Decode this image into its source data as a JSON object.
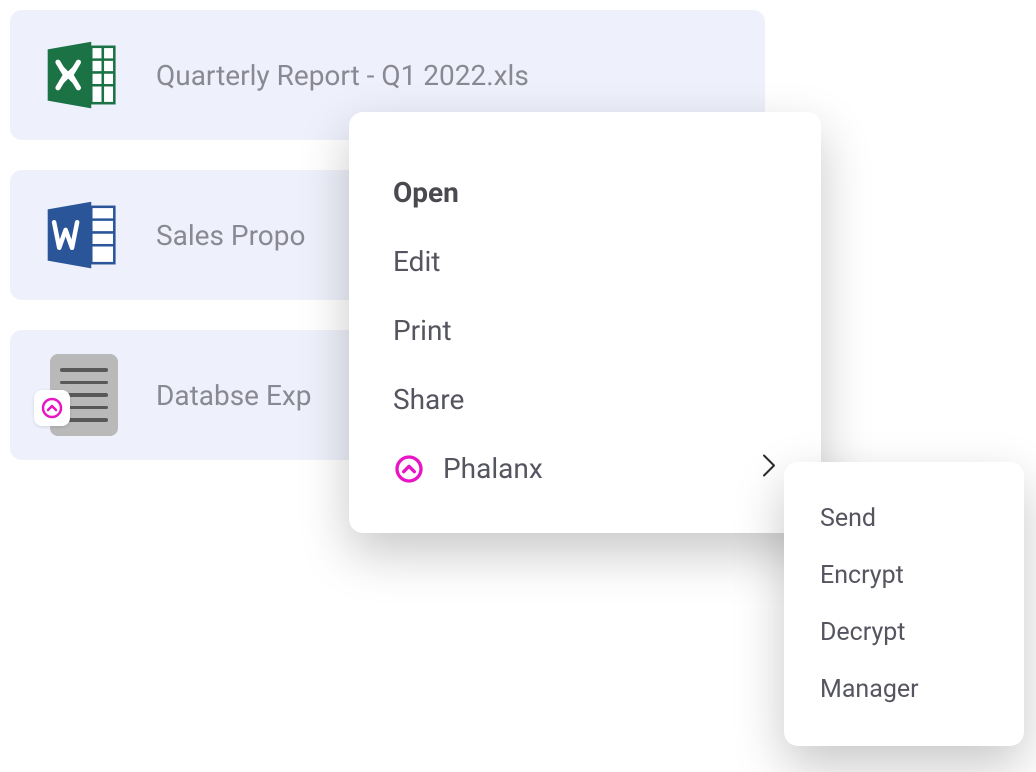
{
  "files": [
    {
      "name": "Quarterly Report - Q1 2022.xls",
      "type": "excel"
    },
    {
      "name": "Sales Propo",
      "type": "word"
    },
    {
      "name": "Databse Exp",
      "type": "text"
    }
  ],
  "context_menu": {
    "items": [
      {
        "label": "Open",
        "bold": true
      },
      {
        "label": "Edit"
      },
      {
        "label": "Print"
      },
      {
        "label": "Share"
      },
      {
        "label": "Phalanx",
        "icon": "phalanx",
        "has_submenu": true
      }
    ]
  },
  "submenu": {
    "items": [
      {
        "label": "Send"
      },
      {
        "label": "Encrypt"
      },
      {
        "label": "Decrypt"
      },
      {
        "label": "Manager"
      }
    ]
  },
  "colors": {
    "excel": "#1b7245",
    "word": "#2a5699",
    "phalanx": "#e815c5"
  }
}
